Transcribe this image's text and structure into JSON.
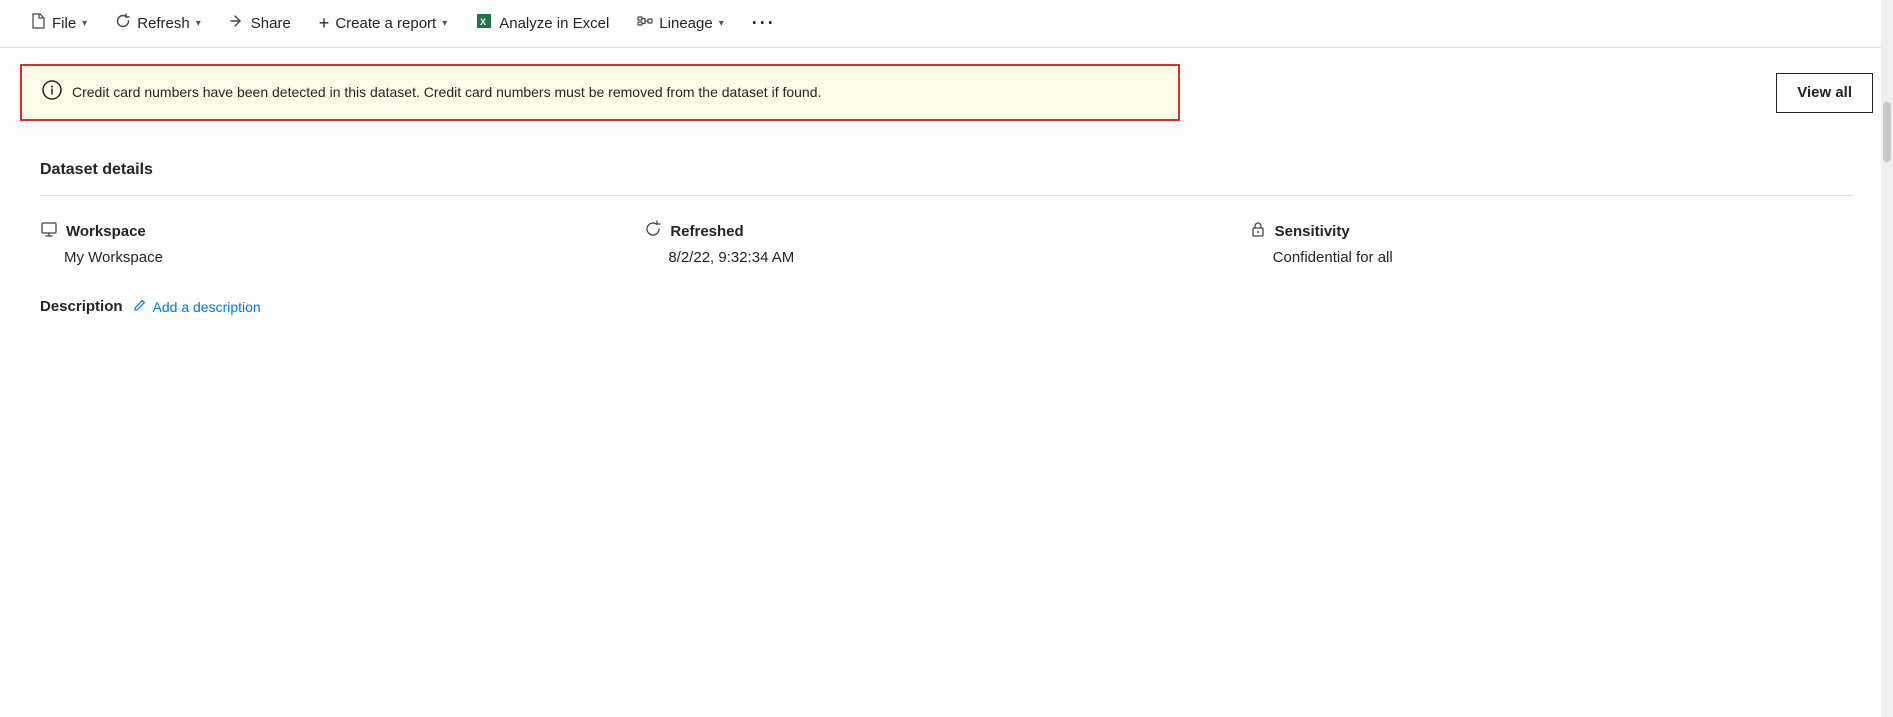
{
  "toolbar": {
    "items": [
      {
        "id": "file",
        "label": "File",
        "icon": "📄",
        "has_chevron": true
      },
      {
        "id": "refresh",
        "label": "Refresh",
        "icon": "↺",
        "has_chevron": true
      },
      {
        "id": "share",
        "label": "Share",
        "icon": "↗",
        "has_chevron": false
      },
      {
        "id": "create-report",
        "label": "Create a report",
        "icon": "+",
        "has_chevron": true
      },
      {
        "id": "analyze-excel",
        "label": "Analyze in Excel",
        "icon": "⊞",
        "has_chevron": false
      },
      {
        "id": "lineage",
        "label": "Lineage",
        "icon": "⋮",
        "has_chevron": true
      },
      {
        "id": "more",
        "label": "...",
        "icon": "",
        "has_chevron": false
      }
    ]
  },
  "alert": {
    "message": "Credit card numbers have been detected in this dataset. Credit card numbers must be removed from the dataset if found.",
    "view_all_label": "View all"
  },
  "dataset": {
    "section_title": "Dataset details",
    "fields": [
      {
        "id": "workspace",
        "label": "Workspace",
        "value": "My Workspace",
        "icon": "🖥"
      },
      {
        "id": "refreshed",
        "label": "Refreshed",
        "value": "8/2/22, 9:32:34 AM",
        "icon": "↺"
      },
      {
        "id": "sensitivity",
        "label": "Sensitivity",
        "value": "Confidential for all",
        "icon": "🔒"
      }
    ],
    "description": {
      "label": "Description",
      "add_link_text": "Add a description"
    }
  }
}
